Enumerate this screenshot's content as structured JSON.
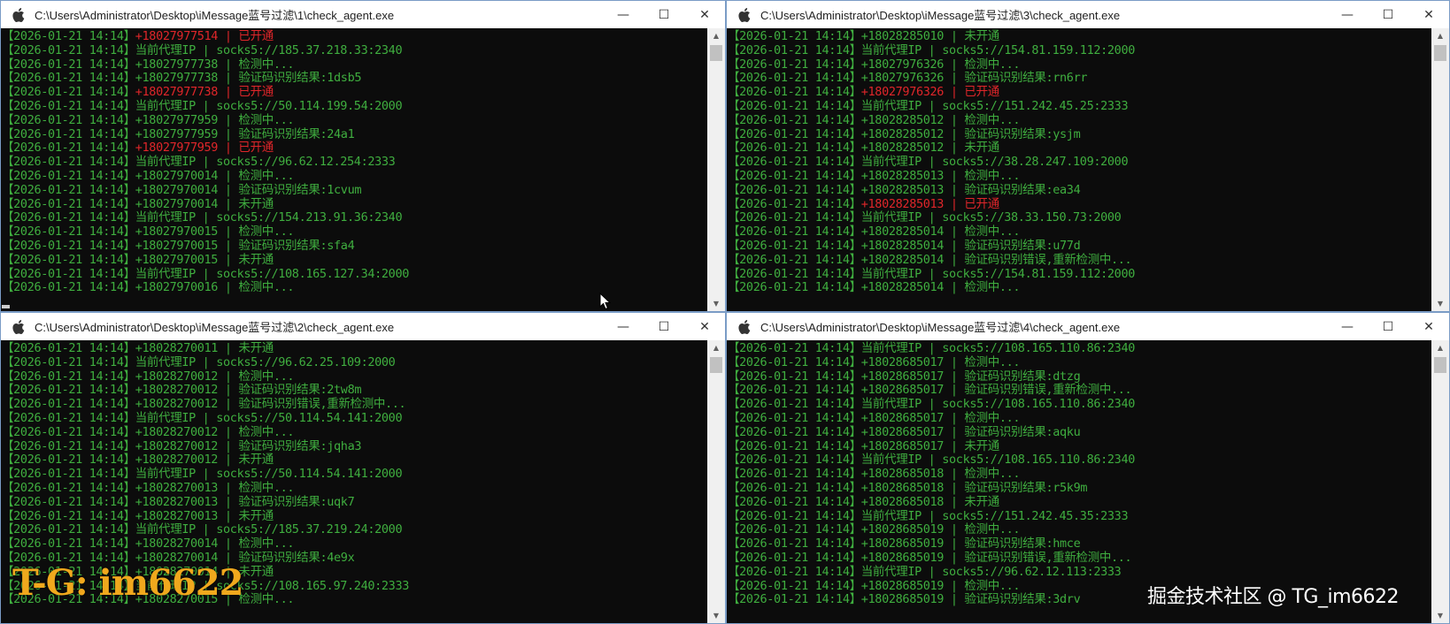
{
  "windows": [
    {
      "title": "C:\\Users\\Administrator\\Desktop\\iMessage蓝号过滤\\1\\check_agent.exe",
      "lines": [
        {
          "ts": "【2026-01-21 14:14】",
          "text": "+18027977514 | 已开通",
          "red": true
        },
        {
          "ts": "【2026-01-21 14:14】",
          "text": "当前代理IP | socks5://185.37.218.33:2340",
          "red": false
        },
        {
          "ts": "【2026-01-21 14:14】",
          "text": "+18027977738 | 检测中...",
          "red": false
        },
        {
          "ts": "【2026-01-21 14:14】",
          "text": "+18027977738 | 验证码识别结果:1dsb5",
          "red": false
        },
        {
          "ts": "【2026-01-21 14:14】",
          "text": "+18027977738 | 已开通",
          "red": true
        },
        {
          "ts": "【2026-01-21 14:14】",
          "text": "当前代理IP | socks5://50.114.199.54:2000",
          "red": false
        },
        {
          "ts": "【2026-01-21 14:14】",
          "text": "+18027977959 | 检测中...",
          "red": false
        },
        {
          "ts": "【2026-01-21 14:14】",
          "text": "+18027977959 | 验证码识别结果:24a1",
          "red": false
        },
        {
          "ts": "【2026-01-21 14:14】",
          "text": "+18027977959 | 已开通",
          "red": true
        },
        {
          "ts": "【2026-01-21 14:14】",
          "text": "当前代理IP | socks5://96.62.12.254:2333",
          "red": false
        },
        {
          "ts": "【2026-01-21 14:14】",
          "text": "+18027970014 | 检测中...",
          "red": false
        },
        {
          "ts": "【2026-01-21 14:14】",
          "text": "+18027970014 | 验证码识别结果:1cvum",
          "red": false
        },
        {
          "ts": "【2026-01-21 14:14】",
          "text": "+18027970014 | 未开通",
          "red": false
        },
        {
          "ts": "【2026-01-21 14:14】",
          "text": "当前代理IP | socks5://154.213.91.36:2340",
          "red": false
        },
        {
          "ts": "【2026-01-21 14:14】",
          "text": "+18027970015 | 检测中...",
          "red": false
        },
        {
          "ts": "【2026-01-21 14:14】",
          "text": "+18027970015 | 验证码识别结果:sfa4",
          "red": false
        },
        {
          "ts": "【2026-01-21 14:14】",
          "text": "+18027970015 | 未开通",
          "red": false
        },
        {
          "ts": "【2026-01-21 14:14】",
          "text": "当前代理IP | socks5://108.165.127.34:2000",
          "red": false
        },
        {
          "ts": "【2026-01-21 14:14】",
          "text": "+18027970016 | 检测中...",
          "red": false
        }
      ]
    },
    {
      "title": "C:\\Users\\Administrator\\Desktop\\iMessage蓝号过滤\\3\\check_agent.exe",
      "lines": [
        {
          "ts": "【2026-01-21 14:14】",
          "text": "+18028285010 | 未开通",
          "red": false
        },
        {
          "ts": "【2026-01-21 14:14】",
          "text": "当前代理IP | socks5://154.81.159.112:2000",
          "red": false
        },
        {
          "ts": "【2026-01-21 14:14】",
          "text": "+18027976326 | 检测中...",
          "red": false
        },
        {
          "ts": "【2026-01-21 14:14】",
          "text": "+18027976326 | 验证码识别结果:rn6rr",
          "red": false
        },
        {
          "ts": "【2026-01-21 14:14】",
          "text": "+18027976326 | 已开通",
          "red": true
        },
        {
          "ts": "【2026-01-21 14:14】",
          "text": "当前代理IP | socks5://151.242.45.25:2333",
          "red": false
        },
        {
          "ts": "【2026-01-21 14:14】",
          "text": "+18028285012 | 检测中...",
          "red": false
        },
        {
          "ts": "【2026-01-21 14:14】",
          "text": "+18028285012 | 验证码识别结果:ysjm",
          "red": false
        },
        {
          "ts": "【2026-01-21 14:14】",
          "text": "+18028285012 | 未开通",
          "red": false
        },
        {
          "ts": "【2026-01-21 14:14】",
          "text": "当前代理IP | socks5://38.28.247.109:2000",
          "red": false
        },
        {
          "ts": "【2026-01-21 14:14】",
          "text": "+18028285013 | 检测中...",
          "red": false
        },
        {
          "ts": "【2026-01-21 14:14】",
          "text": "+18028285013 | 验证码识别结果:ea34",
          "red": false
        },
        {
          "ts": "【2026-01-21 14:14】",
          "text": "+18028285013 | 已开通",
          "red": true
        },
        {
          "ts": "【2026-01-21 14:14】",
          "text": "当前代理IP | socks5://38.33.150.73:2000",
          "red": false
        },
        {
          "ts": "【2026-01-21 14:14】",
          "text": "+18028285014 | 检测中...",
          "red": false
        },
        {
          "ts": "【2026-01-21 14:14】",
          "text": "+18028285014 | 验证码识别结果:u77d",
          "red": false
        },
        {
          "ts": "【2026-01-21 14:14】",
          "text": "+18028285014 | 验证码识别错误,重新检测中...",
          "red": false
        },
        {
          "ts": "【2026-01-21 14:14】",
          "text": "当前代理IP | socks5://154.81.159.112:2000",
          "red": false
        },
        {
          "ts": "【2026-01-21 14:14】",
          "text": "+18028285014 | 检测中...",
          "red": false
        }
      ]
    },
    {
      "title": "C:\\Users\\Administrator\\Desktop\\iMessage蓝号过滤\\2\\check_agent.exe",
      "lines": [
        {
          "ts": "【2026-01-21 14:14】",
          "text": "+18028270011 | 未开通",
          "red": false
        },
        {
          "ts": "【2026-01-21 14:14】",
          "text": "当前代理IP | socks5://96.62.25.109:2000",
          "red": false
        },
        {
          "ts": "【2026-01-21 14:14】",
          "text": "+18028270012 | 检测中...",
          "red": false
        },
        {
          "ts": "【2026-01-21 14:14】",
          "text": "+18028270012 | 验证码识别结果:2tw8m",
          "red": false
        },
        {
          "ts": "【2026-01-21 14:14】",
          "text": "+18028270012 | 验证码识别错误,重新检测中...",
          "red": false
        },
        {
          "ts": "【2026-01-21 14:14】",
          "text": "当前代理IP | socks5://50.114.54.141:2000",
          "red": false
        },
        {
          "ts": "【2026-01-21 14:14】",
          "text": "+18028270012 | 检测中...",
          "red": false
        },
        {
          "ts": "【2026-01-21 14:14】",
          "text": "+18028270012 | 验证码识别结果:jqha3",
          "red": false
        },
        {
          "ts": "【2026-01-21 14:14】",
          "text": "+18028270012 | 未开通",
          "red": false
        },
        {
          "ts": "【2026-01-21 14:14】",
          "text": "当前代理IP | socks5://50.114.54.141:2000",
          "red": false
        },
        {
          "ts": "【2026-01-21 14:14】",
          "text": "+18028270013 | 检测中...",
          "red": false
        },
        {
          "ts": "【2026-01-21 14:14】",
          "text": "+18028270013 | 验证码识别结果:uqk7",
          "red": false
        },
        {
          "ts": "【2026-01-21 14:14】",
          "text": "+18028270013 | 未开通",
          "red": false
        },
        {
          "ts": "【2026-01-21 14:14】",
          "text": "当前代理IP | socks5://185.37.219.24:2000",
          "red": false
        },
        {
          "ts": "【2026-01-21 14:14】",
          "text": "+18028270014 | 检测中...",
          "red": false
        },
        {
          "ts": "【2026-01-21 14:14】",
          "text": "+18028270014 | 验证码识别结果:4e9x",
          "red": false
        },
        {
          "ts": "【2026-01-21 14:14】",
          "text": "+18028270014 | 未开通",
          "red": false
        },
        {
          "ts": "【2026-01-21 14:14】",
          "text": "当前代理IP | socks5://108.165.97.240:2333",
          "red": false
        },
        {
          "ts": "【2026-01-21 14:14】",
          "text": "+18028270015 | 检测中...",
          "red": false
        }
      ]
    },
    {
      "title": "C:\\Users\\Administrator\\Desktop\\iMessage蓝号过滤\\4\\check_agent.exe",
      "lines": [
        {
          "ts": "【2026-01-21 14:14】",
          "text": "当前代理IP | socks5://108.165.110.86:2340",
          "red": false
        },
        {
          "ts": "【2026-01-21 14:14】",
          "text": "+18028685017 | 检测中...",
          "red": false
        },
        {
          "ts": "【2026-01-21 14:14】",
          "text": "+18028685017 | 验证码识别结果:dtzg",
          "red": false
        },
        {
          "ts": "【2026-01-21 14:14】",
          "text": "+18028685017 | 验证码识别错误,重新检测中...",
          "red": false
        },
        {
          "ts": "【2026-01-21 14:14】",
          "text": "当前代理IP | socks5://108.165.110.86:2340",
          "red": false
        },
        {
          "ts": "【2026-01-21 14:14】",
          "text": "+18028685017 | 检测中...",
          "red": false
        },
        {
          "ts": "【2026-01-21 14:14】",
          "text": "+18028685017 | 验证码识别结果:aqku",
          "red": false
        },
        {
          "ts": "【2026-01-21 14:14】",
          "text": "+18028685017 | 未开通",
          "red": false
        },
        {
          "ts": "【2026-01-21 14:14】",
          "text": "当前代理IP | socks5://108.165.110.86:2340",
          "red": false
        },
        {
          "ts": "【2026-01-21 14:14】",
          "text": "+18028685018 | 检测中...",
          "red": false
        },
        {
          "ts": "【2026-01-21 14:14】",
          "text": "+18028685018 | 验证码识别结果:r5k9m",
          "red": false
        },
        {
          "ts": "【2026-01-21 14:14】",
          "text": "+18028685018 | 未开通",
          "red": false
        },
        {
          "ts": "【2026-01-21 14:14】",
          "text": "当前代理IP | socks5://151.242.45.35:2333",
          "red": false
        },
        {
          "ts": "【2026-01-21 14:14】",
          "text": "+18028685019 | 检测中...",
          "red": false
        },
        {
          "ts": "【2026-01-21 14:14】",
          "text": "+18028685019 | 验证码识别结果:hmce",
          "red": false
        },
        {
          "ts": "【2026-01-21 14:14】",
          "text": "+18028685019 | 验证码识别错误,重新检测中...",
          "red": false
        },
        {
          "ts": "【2026-01-21 14:14】",
          "text": "当前代理IP | socks5://96.62.12.113:2333",
          "red": false
        },
        {
          "ts": "【2026-01-21 14:14】",
          "text": "+18028685019 | 检测中...",
          "red": false
        },
        {
          "ts": "【2026-01-21 14:14】",
          "text": "+18028685019 | 验证码识别结果:3drv",
          "red": false
        }
      ]
    }
  ],
  "controls": {
    "minimize": "—",
    "maximize": "☐",
    "close": "✕"
  },
  "icons": {
    "app": "apple-icon",
    "minimize": "minimize-icon",
    "maximize": "maximize-icon",
    "close": "close-icon"
  },
  "colors": {
    "console_bg": "#0c0c0c",
    "text_green": "#3fae3f",
    "text_red": "#e0262a",
    "watermark_orange": "#f0a81d"
  },
  "watermarks": {
    "tg": "T-G: im6622",
    "juejin": "掘金技术社区 @ TG_im6622"
  }
}
